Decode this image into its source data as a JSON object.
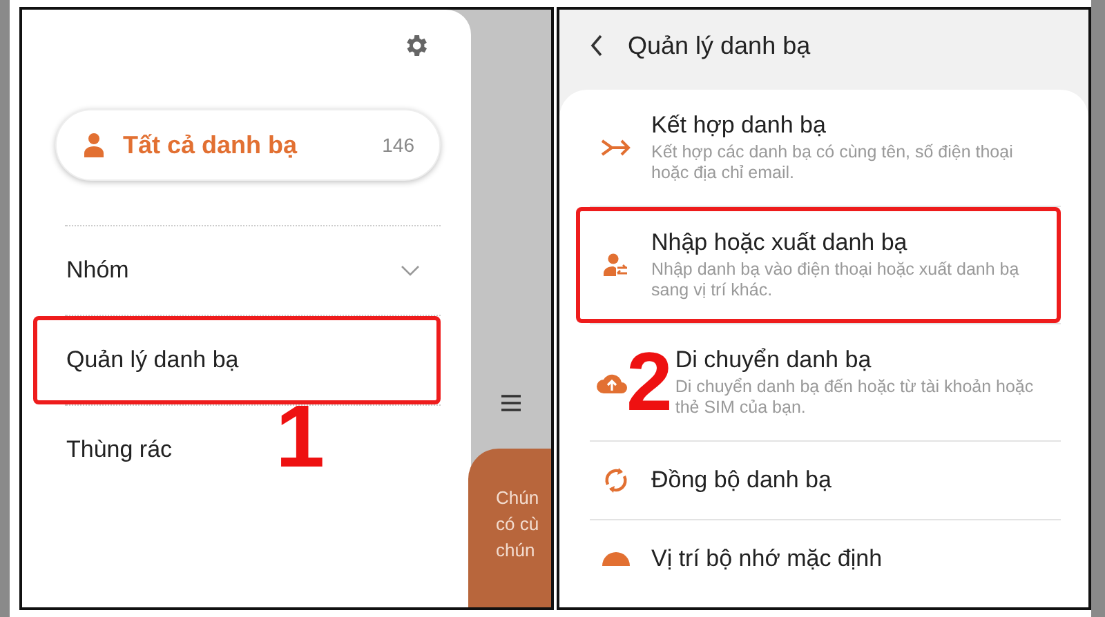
{
  "left_screen": {
    "all_contacts": {
      "label": "Tất cả danh bạ",
      "count": "146"
    },
    "menu": [
      {
        "label": "Nhóm",
        "kind": "expandable",
        "highlighted": false
      },
      {
        "label": "Quản lý danh bạ",
        "kind": "plain",
        "highlighted": true
      },
      {
        "label": "Thùng rác",
        "kind": "plain",
        "highlighted": false,
        "step_number": "1"
      }
    ],
    "background_card_lines": [
      "Chún",
      "có cù",
      "chún"
    ]
  },
  "right_screen": {
    "title": "Quản lý danh bạ",
    "rows": [
      {
        "kind": "merge",
        "title": "Kết hợp danh bạ",
        "description": "Kết hợp các danh bạ có cùng tên, số điện thoại hoặc địa chỉ email.",
        "highlighted": false
      },
      {
        "kind": "import-export",
        "title": "Nhập hoặc xuất danh bạ",
        "description": "Nhập danh bạ vào điện thoại hoặc xuất danh bạ sang vị trí khác.",
        "highlighted": true
      },
      {
        "kind": "move",
        "title": "Di chuyển danh bạ",
        "description": "Di chuyển danh bạ đến hoặc từ tài khoản hoặc thẻ SIM của bạn.",
        "highlighted": false,
        "step_number": "2"
      },
      {
        "kind": "sync",
        "title": "Đồng bộ danh bạ",
        "highlighted": false
      },
      {
        "kind": "storage",
        "title": "Vị trí bộ nhớ mặc định",
        "highlighted": false
      }
    ]
  }
}
